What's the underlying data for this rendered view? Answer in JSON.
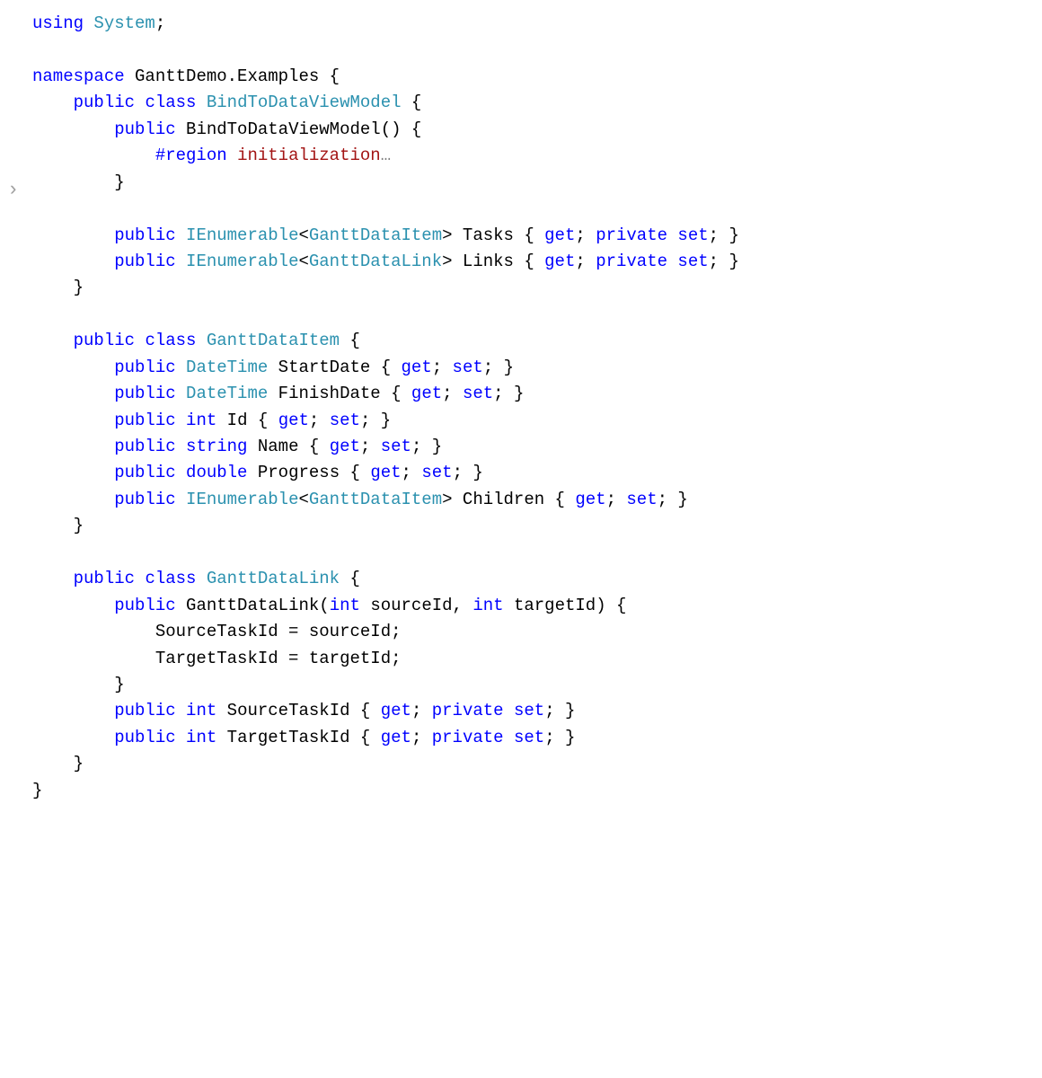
{
  "gutter": {
    "marker_line_index": 5,
    "marker_glyph": "›"
  },
  "kw": {
    "using": "using",
    "namespace": "namespace",
    "public": "public",
    "class": "class",
    "get": "get",
    "set": "set",
    "private": "private",
    "int": "int",
    "string": "string",
    "double": "double",
    "region": "#region"
  },
  "types": {
    "System": "System",
    "IEnumerable": "IEnumerable",
    "GanttDataItem": "GanttDataItem",
    "GanttDataLink": "GanttDataLink",
    "DateTime": "DateTime"
  },
  "ids": {
    "ns": "GanttDemo.Examples",
    "BindToDataViewModel": "BindToDataViewModel",
    "Tasks": "Tasks",
    "Links": "Links",
    "StartDate": "StartDate",
    "FinishDate": "FinishDate",
    "Id": "Id",
    "Name": "Name",
    "Progress": "Progress",
    "Children": "Children",
    "GanttDataLinkCtor": "GanttDataLink",
    "sourceId": "sourceId",
    "targetId": "targetId",
    "SourceTaskId": "SourceTaskId",
    "TargetTaskId": "TargetTaskId"
  },
  "region": {
    "name": "initialization",
    "dots": "…"
  },
  "chart_data": {
    "type": "table",
    "title": "C# source — GanttDemo.Examples",
    "series": [
      {
        "name": "BindToDataViewModel",
        "members": [
          {
            "name": "BindToDataViewModel()",
            "kind": "constructor",
            "region": "initialization"
          },
          {
            "name": "Tasks",
            "type": "IEnumerable<GanttDataItem>",
            "get": "public",
            "set": "private"
          },
          {
            "name": "Links",
            "type": "IEnumerable<GanttDataLink>",
            "get": "public",
            "set": "private"
          }
        ]
      },
      {
        "name": "GanttDataItem",
        "members": [
          {
            "name": "StartDate",
            "type": "DateTime",
            "get": "public",
            "set": "public"
          },
          {
            "name": "FinishDate",
            "type": "DateTime",
            "get": "public",
            "set": "public"
          },
          {
            "name": "Id",
            "type": "int",
            "get": "public",
            "set": "public"
          },
          {
            "name": "Name",
            "type": "string",
            "get": "public",
            "set": "public"
          },
          {
            "name": "Progress",
            "type": "double",
            "get": "public",
            "set": "public"
          },
          {
            "name": "Children",
            "type": "IEnumerable<GanttDataItem>",
            "get": "public",
            "set": "public"
          }
        ]
      },
      {
        "name": "GanttDataLink",
        "members": [
          {
            "name": "GanttDataLink(int sourceId, int targetId)",
            "kind": "constructor"
          },
          {
            "name": "SourceTaskId",
            "type": "int",
            "get": "public",
            "set": "private"
          },
          {
            "name": "TargetTaskId",
            "type": "int",
            "get": "public",
            "set": "private"
          }
        ]
      }
    ]
  }
}
